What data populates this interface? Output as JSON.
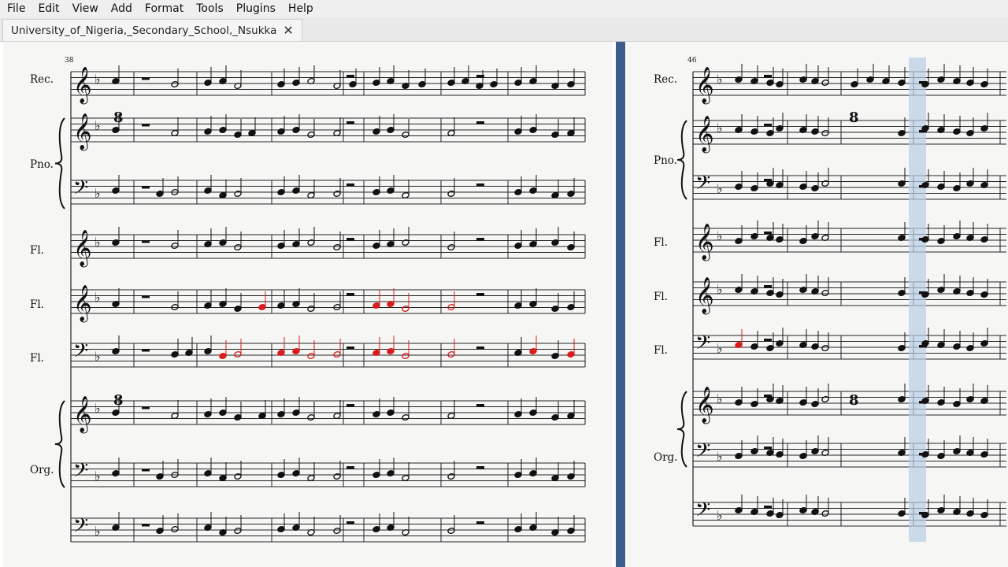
{
  "menu": [
    "File",
    "Edit",
    "View",
    "Add",
    "Format",
    "Tools",
    "Plugins",
    "Help"
  ],
  "tab": {
    "title": "University_of_Nigeria,_Secondary_School,_Nsukka",
    "close_icon": "close-icon"
  },
  "score": {
    "page1": {
      "measure_number": "38",
      "instruments": [
        "Rec.",
        "Pno.",
        "Fl.",
        "Fl.",
        "Fl.",
        "Org."
      ]
    },
    "page2": {
      "measure_number": "46",
      "instruments": [
        "Rec.",
        "Pno.",
        "Fl.",
        "Fl.",
        "Fl.",
        "Org."
      ]
    },
    "colors": {
      "page_bg": "#f6f7f5",
      "divider": "#3d5e8c",
      "selection": "#b8cde6",
      "highlight_note": "#d91c1c"
    }
  }
}
